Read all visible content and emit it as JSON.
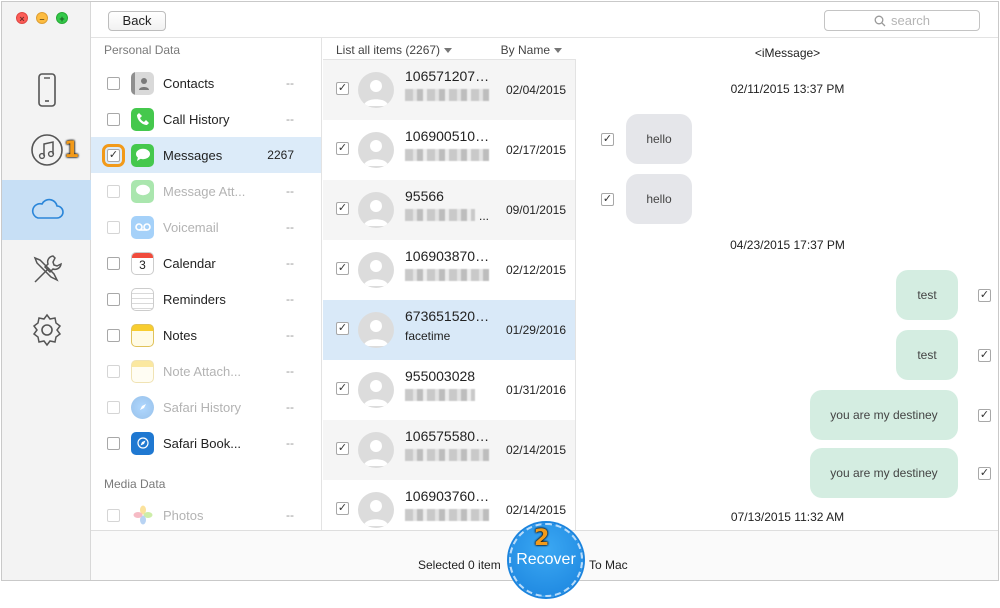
{
  "toolbar": {
    "back_label": "Back",
    "search_placeholder": "search"
  },
  "rail": {
    "items": [
      "device-icon",
      "itunes-icon",
      "icloud-icon",
      "tools-icon",
      "settings-icon"
    ],
    "active": "icloud-icon"
  },
  "steps": {
    "step1": "1",
    "step2": "2"
  },
  "categories": {
    "personal_header": "Personal Data",
    "media_header": "Media Data",
    "items": [
      {
        "label": "Contacts",
        "count": "--",
        "icon": "contacts-icon"
      },
      {
        "label": "Call History",
        "count": "--",
        "icon": "phone-icon"
      },
      {
        "label": "Messages",
        "count": "2267",
        "icon": "messages-icon",
        "checked": true,
        "selected": true
      },
      {
        "label": "Message Att...",
        "count": "--",
        "icon": "message-attachment-icon",
        "disabled": true
      },
      {
        "label": "Voicemail",
        "count": "--",
        "icon": "voicemail-icon",
        "disabled": true
      },
      {
        "label": "Calendar",
        "count": "--",
        "icon": "calendar-icon",
        "calendar_day": "3"
      },
      {
        "label": "Reminders",
        "count": "--",
        "icon": "reminders-icon"
      },
      {
        "label": "Notes",
        "count": "--",
        "icon": "notes-icon"
      },
      {
        "label": "Note Attach...",
        "count": "--",
        "icon": "note-attachment-icon",
        "disabled": true
      },
      {
        "label": "Safari History",
        "count": "--",
        "icon": "safari-icon",
        "disabled": true
      },
      {
        "label": "Safari Book...",
        "count": "--",
        "icon": "safari-bookmark-icon"
      },
      {
        "label": "Photos",
        "count": "--",
        "icon": "photos-icon",
        "disabled": true
      }
    ]
  },
  "list": {
    "header_left": "List all items (2267)",
    "header_right": "By Name",
    "rows": [
      {
        "number": "106571207…",
        "preview": "",
        "date": "02/04/2015"
      },
      {
        "number": "106900510…",
        "preview": "",
        "date": "02/17/2015"
      },
      {
        "number": "95566",
        "preview": "",
        "date": "09/01/2015",
        "ellipsis": "..."
      },
      {
        "number": "106903870…",
        "preview": "",
        "date": "02/12/2015"
      },
      {
        "number": "673651520…",
        "preview": "facetime",
        "date": "01/29/2016",
        "selected": true
      },
      {
        "number": "955003028",
        "preview": "",
        "date": "01/31/2016"
      },
      {
        "number": "106575580…",
        "preview": "",
        "date": "02/14/2015"
      },
      {
        "number": "106903760…",
        "preview": "",
        "date": "02/14/2015"
      }
    ]
  },
  "conversation": {
    "title": "<iMessage>",
    "timestamps": [
      "02/11/2015 13:37 PM",
      "04/23/2015 17:37 PM",
      "07/13/2015 11:32 AM"
    ],
    "messages": [
      {
        "text": "hello",
        "dir": "in"
      },
      {
        "text": "hello",
        "dir": "in"
      },
      {
        "text": "test",
        "dir": "out"
      },
      {
        "text": "test",
        "dir": "out"
      },
      {
        "text": "you are my destiney",
        "dir": "out"
      },
      {
        "text": "you are my destiney",
        "dir": "out"
      }
    ]
  },
  "bottom": {
    "selected_text": "Selected 0 item",
    "recover_label": "Recover",
    "to_mac": "To Mac"
  },
  "colors": {
    "accent": "#1b84de",
    "highlight": "#f29a1a",
    "selected_row": "#d9e9f8",
    "outgoing": "#d4ede1",
    "incoming": "#e5e6ea"
  }
}
